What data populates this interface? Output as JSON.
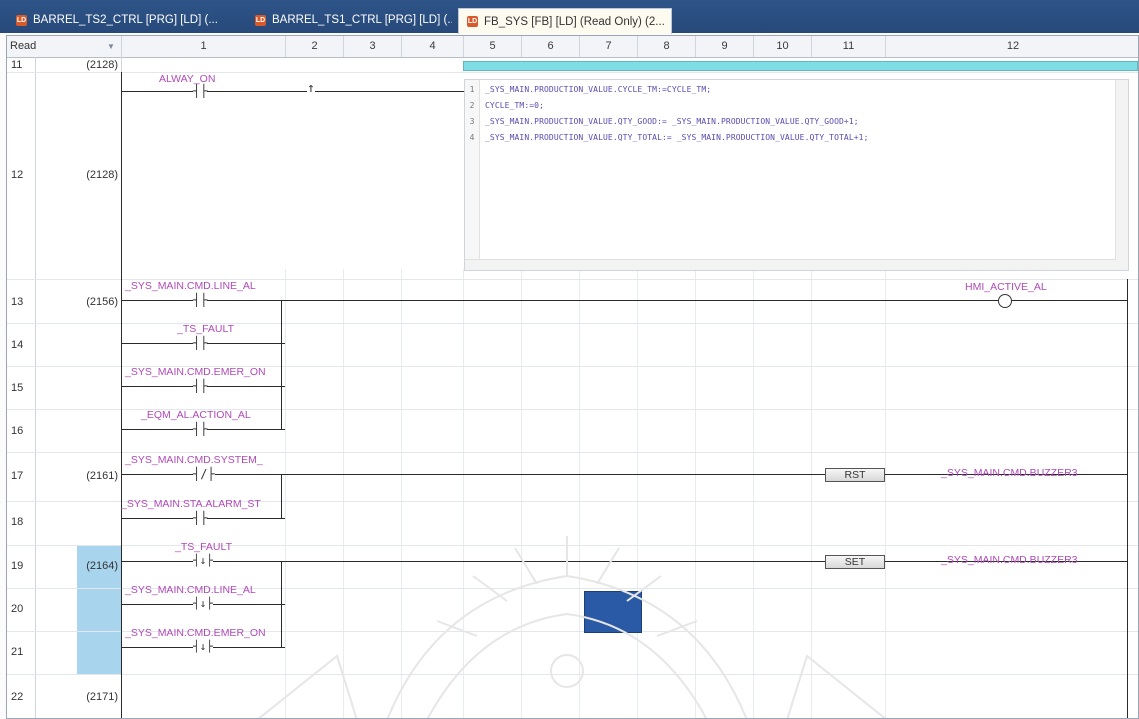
{
  "tabs": [
    {
      "label": "BARREL_TS2_CTRL [PRG] [LD] (...",
      "active": false
    },
    {
      "label": "BARREL_TS1_CTRL [PRG] [LD] (...",
      "active": false
    },
    {
      "label": "FB_SYS [FB] [LD] (Read Only) (2...",
      "active": true
    }
  ],
  "tab_close_glyph": "×",
  "editor": {
    "mode_label": "Read",
    "columns": [
      "1",
      "2",
      "3",
      "4",
      "5",
      "6",
      "7",
      "8",
      "9",
      "10",
      "11",
      "12"
    ],
    "rows": [
      "11",
      "12",
      "13",
      "14",
      "15",
      "16",
      "17",
      "18",
      "19",
      "20",
      "21",
      "22"
    ],
    "steps": {
      "r11": "(2128)",
      "r12": "(2128)",
      "r13": "(2156)",
      "r17": "(2161)",
      "r19": "(2164)",
      "r22": "(2171)"
    }
  },
  "rungs": {
    "alway_on": "ALWAY_ON",
    "line_al": "_SYS_MAIN.CMD.LINE_AL",
    "ts_fault": "_TS_FAULT",
    "emer_on": "_SYS_MAIN.CMD.EMER_ON",
    "eqm_action_al": "_EQM_AL.ACTION_AL",
    "hmi_active_al": "HMI_ACTIVE_AL",
    "system": "_SYS_MAIN.CMD.SYSTEM_",
    "alarm_st": "_SYS_MAIN.STA.ALARM_ST",
    "rst": "RST",
    "buzzer_a": "_SYS_MAIN.CMD.BUZZER3",
    "ts_fault_2": "_TS_FAULT",
    "line_al_2": "_SYS_MAIN.CMD.LINE_AL",
    "emer_on_2": "_SYS_MAIN.CMD.EMER_ON",
    "set": "SET",
    "buzzer_b": "_SYS_MAIN.CMD.BUZZER3"
  },
  "st_code": [
    {
      "n": "1",
      "text": "_SYS_MAIN.PRODUCTION_VALUE.CYCLE_TM:=CYCLE_TM;"
    },
    {
      "n": "2",
      "text": "CYCLE_TM:=0;"
    },
    {
      "n": "3",
      "text": "_SYS_MAIN.PRODUCTION_VALUE.QTY_GOOD:= _SYS_MAIN.PRODUCTION_VALUE.QTY_GOOD+1;"
    },
    {
      "n": "4",
      "text": "_SYS_MAIN.PRODUCTION_VALUE.QTY_TOTAL:= _SYS_MAIN.PRODUCTION_VALUE.QTY_TOTAL+1;"
    }
  ],
  "icons": {
    "tab": "ladder-program-icon",
    "rising_edge": "rising-edge-arrow-icon",
    "dropdown": "chevron-down-icon"
  },
  "colors": {
    "tabbar": "#2b4f80",
    "label": "#b04ab8",
    "st_header": "#7fdde6",
    "highlight": "#a9d4ee"
  }
}
